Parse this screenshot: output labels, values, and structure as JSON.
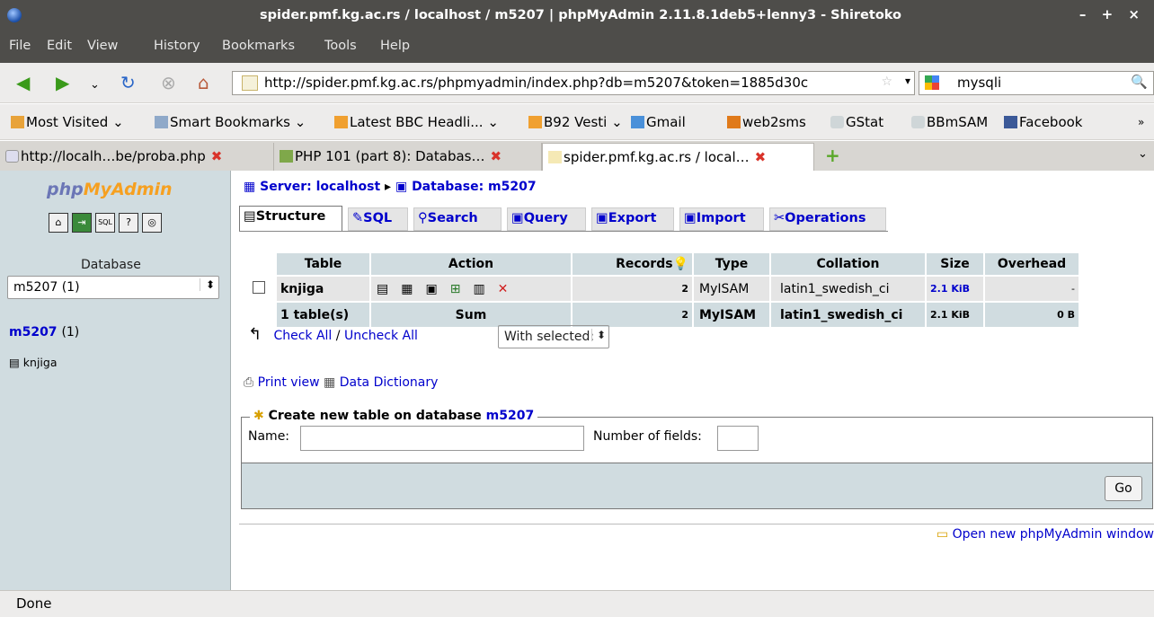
{
  "window": {
    "title": "spider.pmf.kg.ac.rs / localhost / m5207 | phpMyAdmin 2.11.8.1deb5+lenny3 - Shiretoko",
    "controls": "– + ×"
  },
  "menu": {
    "items": [
      "File",
      "Edit",
      "View",
      "History",
      "Bookmarks",
      "Tools",
      "Help"
    ]
  },
  "nav": {
    "url": "http://spider.pmf.kg.ac.rs/phpmyadmin/index.php?db=m5207&token=1885d30c",
    "search": "mysqli"
  },
  "bookmarks": {
    "items": [
      "Most Visited",
      "Smart Bookmarks",
      "Latest BBC Headli...",
      "B92 Vesti",
      "Gmail",
      "web2sms",
      "GStat",
      "BBmSAM",
      "Facebook"
    ],
    "more": "»"
  },
  "tabs": {
    "items": [
      "http://localh…be/proba.php",
      "PHP 101 (part 8): Databas…",
      "spider.pmf.kg.ac.rs / local…"
    ]
  },
  "sidebar": {
    "logo_a": "php",
    "logo_b": "MyAdmin",
    "db_label": "Database",
    "db_selected": "m5207 (1)",
    "db_name": "m5207",
    "db_count": "(1)",
    "table_item": "knjiga"
  },
  "main": {
    "server_label": "Server: localhost",
    "database_label": "Database: m5207",
    "tabs": [
      "Structure",
      "SQL",
      "Search",
      "Query",
      "Export",
      "Import",
      "Operations"
    ],
    "table": {
      "headers": [
        "Table",
        "Action",
        "Records",
        "Type",
        "Collation",
        "Size",
        "Overhead"
      ],
      "row": {
        "name": "knjiga",
        "records": "2",
        "type": "MyISAM",
        "collation": "latin1_swedish_ci",
        "size": "2.1 KiB",
        "overhead": "-"
      },
      "sum": {
        "name": "1 table(s)",
        "label": "Sum",
        "records": "2",
        "type": "MyISAM",
        "collation": "latin1_swedish_ci",
        "size": "2.1 KiB",
        "overhead": "0 B"
      }
    },
    "check_all": "Check All",
    "separator": "/",
    "uncheck_all": "Uncheck All",
    "with_selected": "With selected:",
    "print_view": "Print view",
    "data_dictionary": "Data Dictionary",
    "create_prefix": "Create new table on database",
    "create_db": "m5207",
    "name_label": "Name:",
    "num_fields_label": "Number of fields:",
    "go": "Go",
    "open_window": "Open new phpMyAdmin window"
  },
  "status": {
    "text": "Done"
  }
}
